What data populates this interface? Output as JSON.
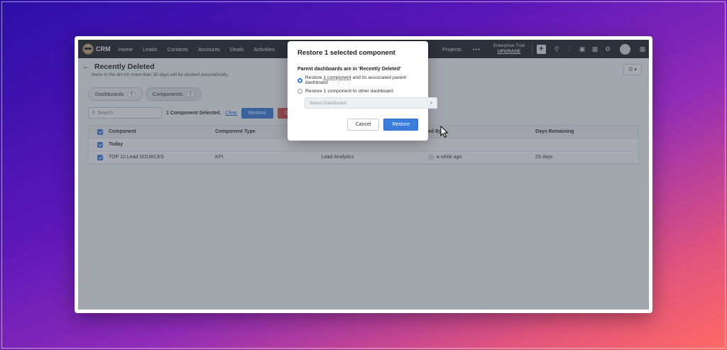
{
  "nav": {
    "logo_text": "CRM",
    "items": [
      "Home",
      "Leads",
      "Contacts",
      "Accounts",
      "Deals",
      "Activities"
    ],
    "projects": "Projects",
    "more": "•••",
    "trial_label": "Enterprise-Trial",
    "upgrade_label": "UPGRADE"
  },
  "page": {
    "title": "Recently Deleted",
    "subtitle": "Items in the bin for more than 30 days will be deleted automatically.",
    "tabs": [
      {
        "label": "Dashboards",
        "count": "1"
      },
      {
        "label": "Components",
        "count": "1"
      }
    ],
    "search_placeholder": "Search",
    "selected_text": "1 Component Selected.",
    "clear_label": "Clear",
    "restore_label": "Restore",
    "delete_label": "Delete"
  },
  "table": {
    "headers": {
      "component": "Component",
      "type": "Component Type",
      "deleted_by": "ed By",
      "days": "Days Remaining"
    },
    "group": "Today",
    "rows": [
      {
        "component": "TOP 10 Lead SOURCES",
        "type": "KPI",
        "dashboard": "Lead Analytics",
        "deleted_by": "a while ago",
        "days": "29 days"
      }
    ]
  },
  "modal": {
    "title": "Restore 1 selected component",
    "subtitle": "Parent dashboards are in 'Recently Deleted'",
    "option1_pre": "Restore ",
    "option1_link": "1 component",
    "option1_post": " and its associated parent dashboard",
    "option2": "Restore 1 component to other dashboard",
    "select_placeholder": "Select Dashboard",
    "cancel_label": "Cancel",
    "restore_label": "Restore"
  }
}
